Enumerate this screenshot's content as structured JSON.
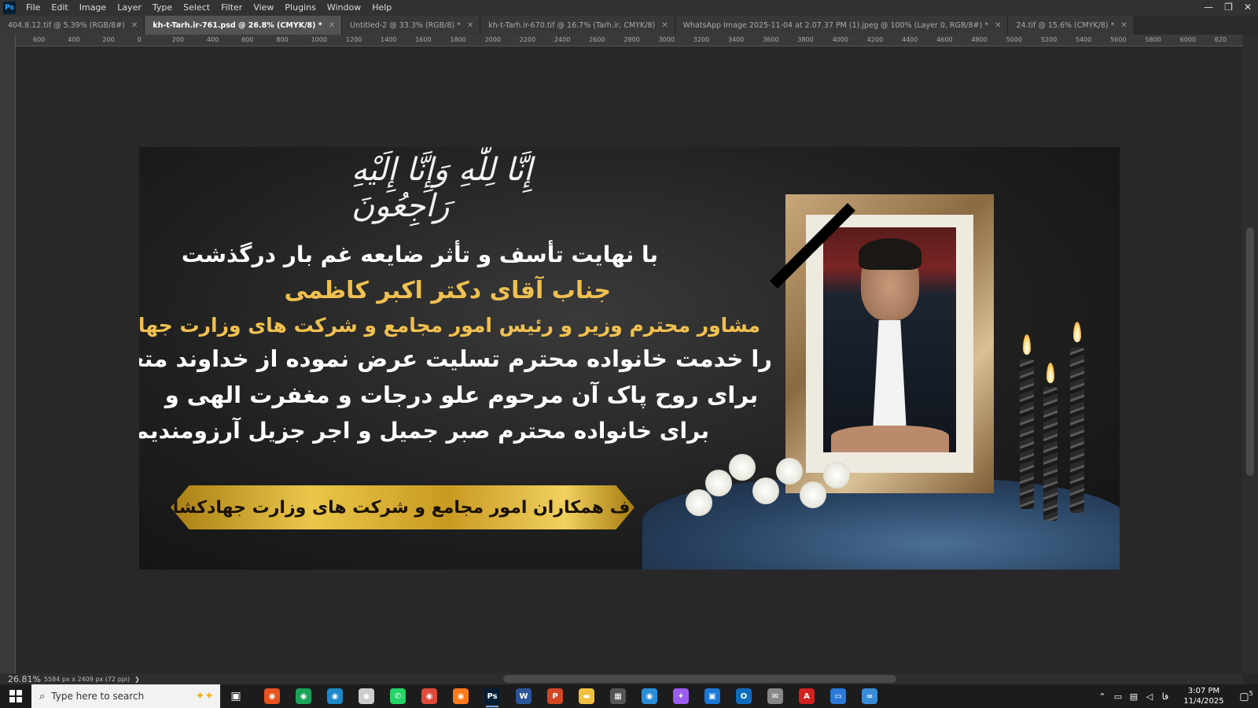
{
  "app": {
    "logo": "Ps",
    "menu": [
      "File",
      "Edit",
      "Image",
      "Layer",
      "Type",
      "Select",
      "Filter",
      "View",
      "Plugins",
      "Window",
      "Help"
    ],
    "window_controls": [
      "—",
      "❐",
      "✕"
    ]
  },
  "tabs": [
    {
      "label": "404.8.12.tif @ 5.39% (RGB/8#)",
      "active": false
    },
    {
      "label": "kh-t-Tarh.ir-761.psd @ 26.8% (CMYK/8) *",
      "active": true
    },
    {
      "label": "Untitled-2 @ 33.3% (RGB/8) *",
      "active": false
    },
    {
      "label": "kh-t-Tarh.ir-670.tif @ 16.7% (Tarh.ir, CMYK/8)",
      "active": false
    },
    {
      "label": "WhatsApp Image 2025-11-04 at 2.07.37 PM (1).jpeg @ 100% (Layer 0, RGB/8#) *",
      "active": false
    },
    {
      "label": "24.tif @ 15.6% (CMYK/8) *",
      "active": false
    }
  ],
  "ruler_top_labels": [
    "600",
    "400",
    "200",
    "0",
    "200",
    "400",
    "600",
    "800",
    "1000",
    "1200",
    "1400",
    "1600",
    "1800",
    "2000",
    "2200",
    "2400",
    "2600",
    "2800",
    "3000",
    "3200",
    "3400",
    "3600",
    "3800",
    "4000",
    "4200",
    "4400",
    "4600",
    "4800",
    "5000",
    "5200",
    "5400",
    "5600",
    "5800",
    "6000",
    "620"
  ],
  "artwork": {
    "calligraphy": "إِنَّا لِلّٰهِ وَإِنَّا إِلَيْهِ رَاجِعُونَ",
    "line1": "با نهایت تأسف و تأثر ضایعه غم بار درگذشت",
    "line2": "جناب آقای دکتر اکبر کاظمی",
    "line3": "مشاور محترم وزیر و رئیس امور مجامع و شرکت های وزارت جهادکشاورزی",
    "line4": "را خدمت خانواده محترم تسلیت عرض نموده از خداوند متعال",
    "line5": "برای روح پاک آن مرحوم علو درجات و مغفرت الهی و",
    "line6": "برای خانواده محترم صبر جمیل و اجر جزیل آرزومندیم.",
    "banner": "از طرف همکاران امور مجامع و شرکت های وزارت جهادکشاورزی"
  },
  "status": {
    "zoom": "26.81%",
    "doc_size": "5584 px x 2409 px (72 ppi)",
    "arrow": "❯"
  },
  "taskbar": {
    "search_placeholder": "Type here to search",
    "apps": [
      {
        "name": "chrome-app-1",
        "glyph": "◉",
        "color": "#e8531f"
      },
      {
        "name": "chrome-app-2",
        "glyph": "◉",
        "color": "#1aa35b"
      },
      {
        "name": "edge-app-1",
        "glyph": "◉",
        "color": "#1e88c8"
      },
      {
        "name": "chrome-app-3",
        "glyph": "◉",
        "color": "#cccccc"
      },
      {
        "name": "whatsapp-app",
        "glyph": "✆",
        "color": "#25d366"
      },
      {
        "name": "chrome-app-4",
        "glyph": "◉",
        "color": "#e04a3a"
      },
      {
        "name": "firefox-app",
        "glyph": "◉",
        "color": "#ff7a1a"
      },
      {
        "name": "photoshop-app",
        "glyph": "Ps",
        "color": "#001e36"
      },
      {
        "name": "word-app",
        "glyph": "W",
        "color": "#2b579a"
      },
      {
        "name": "powerpoint-app",
        "glyph": "P",
        "color": "#d24726"
      },
      {
        "name": "explorer-app",
        "glyph": "▬",
        "color": "#f0c040"
      },
      {
        "name": "calculator-app",
        "glyph": "▦",
        "color": "#555555"
      },
      {
        "name": "edge-app-2",
        "glyph": "◉",
        "color": "#2a8fd8"
      },
      {
        "name": "copilot-app",
        "glyph": "✦",
        "color": "#9b5cf0"
      },
      {
        "name": "store-app",
        "glyph": "▣",
        "color": "#1b78d6"
      },
      {
        "name": "outlook-app",
        "glyph": "O",
        "color": "#0f6cbd"
      },
      {
        "name": "mail-app",
        "glyph": "✉",
        "color": "#888888"
      },
      {
        "name": "acrobat-app",
        "glyph": "A",
        "color": "#d2221f"
      },
      {
        "name": "monitor-app",
        "glyph": "▭",
        "color": "#2a7ad6"
      },
      {
        "name": "network-app",
        "glyph": "∞",
        "color": "#3b8cd8"
      }
    ],
    "tray_lang": "فا",
    "time": "3:07 PM",
    "date": "11/4/2025",
    "notification_count": "5"
  }
}
